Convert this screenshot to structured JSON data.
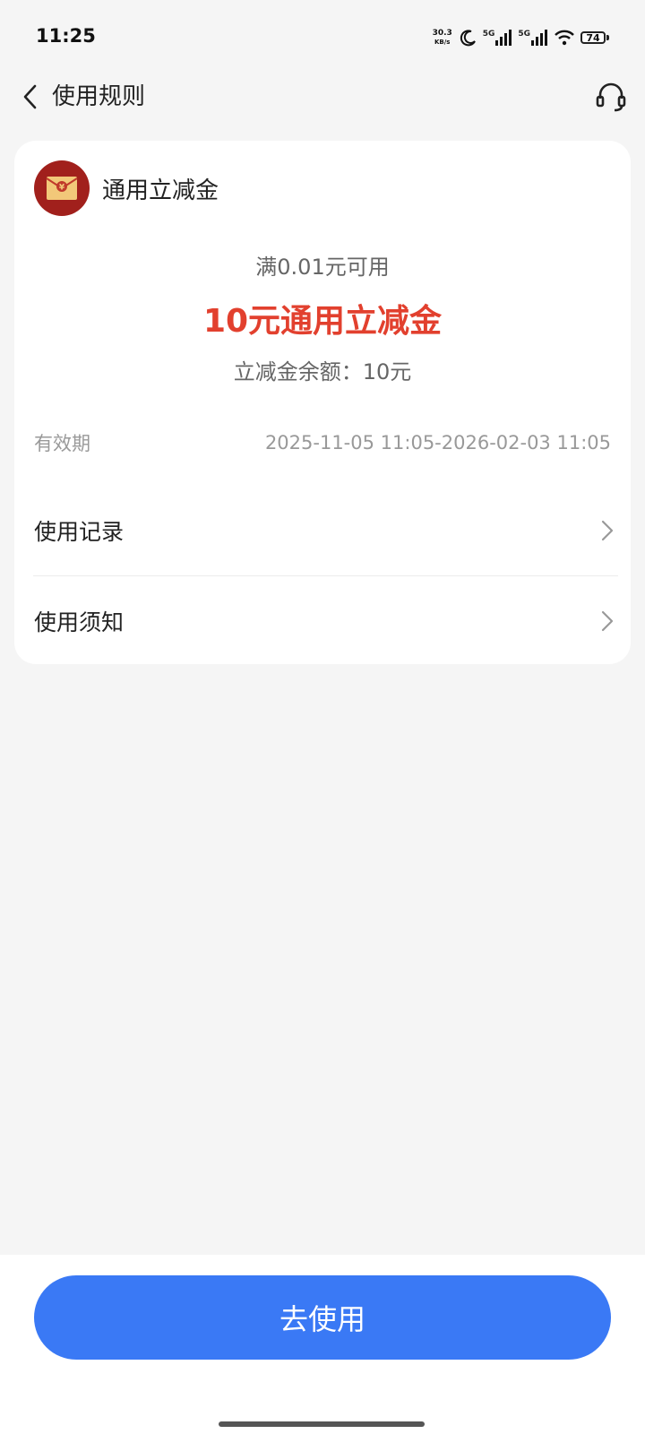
{
  "status_bar": {
    "time": "11:25",
    "net_speed_value": "30.3",
    "net_speed_unit": "KB/s",
    "signal1_label": "5G",
    "signal2_label": "5G",
    "battery": "74",
    "icons": [
      "moon-icon",
      "signal-icon",
      "signal-icon",
      "wifi-icon",
      "battery-icon"
    ]
  },
  "header": {
    "title": "使用规则",
    "back_icon": "chevron-left-icon",
    "support_icon": "headset-icon"
  },
  "coupon": {
    "name": "通用立减金",
    "icon": "red-envelope-icon",
    "envelope_symbol": "¥",
    "condition": "满0.01元可用",
    "amount_title": "10元通用立减金",
    "balance": "立减金余额：10元",
    "validity_label": "有效期",
    "validity_value": "2025-11-05 11:05-2026-02-03 11:05"
  },
  "rows": [
    {
      "label": "使用记录",
      "icon": "chevron-right-icon"
    },
    {
      "label": "使用须知",
      "icon": "chevron-right-icon"
    }
  ],
  "cta": {
    "label": "去使用"
  },
  "colors": {
    "accent_blue": "#3a79f5",
    "amount_red": "#e2402e",
    "envelope_red": "#a1201c",
    "envelope_gold": "#f2c879",
    "background": "#f5f5f5"
  }
}
